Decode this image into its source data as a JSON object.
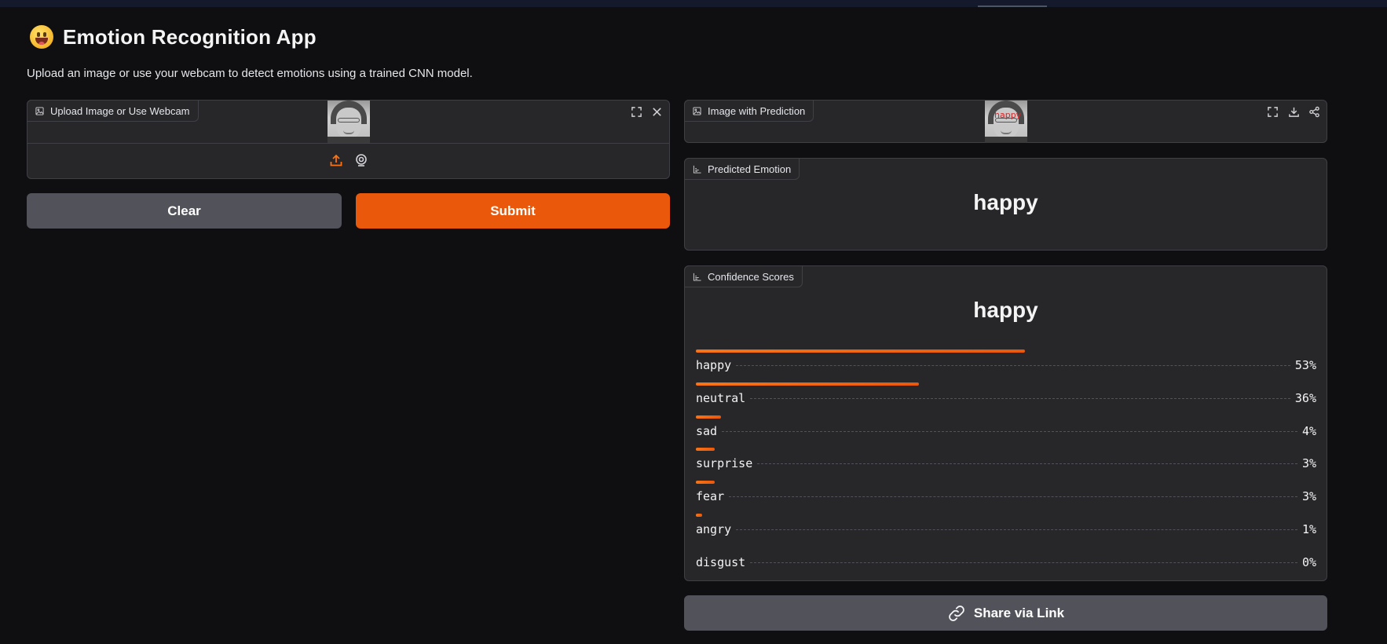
{
  "app": {
    "title": "Emotion Recognition App",
    "description": "Upload an image or use your webcam to detect emotions using a trained CNN model."
  },
  "input_panel": {
    "label": "Upload Image or Use Webcam",
    "icons": [
      "fullscreen-icon",
      "close-icon",
      "upload-icon",
      "webcam-icon"
    ]
  },
  "actions": {
    "clear_label": "Clear",
    "submit_label": "Submit"
  },
  "output_image_panel": {
    "label": "Image with Prediction",
    "overlay_text": "happy",
    "icons": [
      "fullscreen-icon",
      "download-icon",
      "share-icon"
    ]
  },
  "predicted_panel": {
    "label": "Predicted Emotion",
    "value": "happy"
  },
  "confidence_panel": {
    "label": "Confidence Scores",
    "top_label": "happy",
    "scores": [
      {
        "name": "happy",
        "value": 0.53,
        "display": "53%"
      },
      {
        "name": "neutral",
        "value": 0.36,
        "display": "36%"
      },
      {
        "name": "sad",
        "value": 0.04,
        "display": "4%"
      },
      {
        "name": "surprise",
        "value": 0.03,
        "display": "3%"
      },
      {
        "name": "fear",
        "value": 0.03,
        "display": "3%"
      },
      {
        "name": "angry",
        "value": 0.01,
        "display": "1%"
      },
      {
        "name": "disgust",
        "value": 0.0,
        "display": "0%"
      }
    ]
  },
  "share": {
    "label": "Share via Link"
  },
  "colors": {
    "background": "#0f0f11",
    "panel": "#27272a",
    "accent": "#ea580c",
    "secondary_button": "#52525b"
  }
}
